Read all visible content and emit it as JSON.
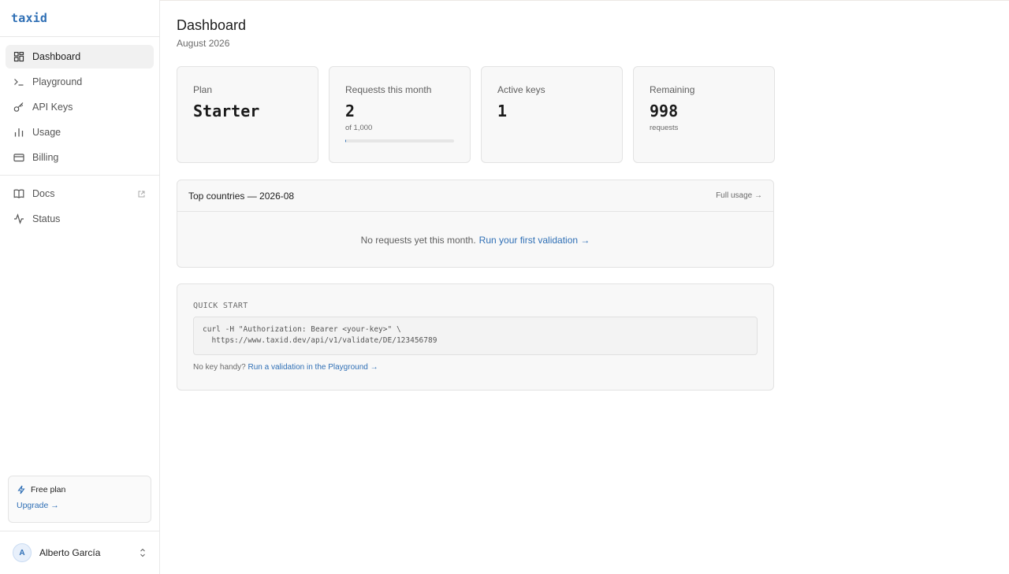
{
  "app": {
    "logo": "taxid"
  },
  "sidebar": {
    "items": [
      {
        "label": "Dashboard",
        "icon": "dashboard-icon",
        "active": true
      },
      {
        "label": "Playground",
        "icon": "terminal-icon"
      },
      {
        "label": "API Keys",
        "icon": "key-icon"
      },
      {
        "label": "Usage",
        "icon": "bar-chart-icon"
      },
      {
        "label": "Billing",
        "icon": "credit-card-icon"
      }
    ],
    "secondary": [
      {
        "label": "Docs",
        "icon": "book-icon",
        "external": true
      },
      {
        "label": "Status",
        "icon": "activity-icon"
      }
    ],
    "plan": {
      "label": "Free plan",
      "upgrade": "Upgrade →"
    },
    "user": {
      "initial": "A",
      "name": "Alberto García"
    }
  },
  "header": {
    "title": "Dashboard",
    "subtitle": "August 2026"
  },
  "cards": [
    {
      "label": "Plan",
      "value": "Starter"
    },
    {
      "label": "Requests this month",
      "value": "2",
      "sub": "of 1,000",
      "progress": 0.002
    },
    {
      "label": "Active keys",
      "value": "1"
    },
    {
      "label": "Remaining",
      "value": "998",
      "sub": "requests"
    }
  ],
  "countries": {
    "title": "Top countries — 2026-08",
    "link": "Full usage →",
    "empty_text": "No requests yet this month.",
    "empty_link": "Run your first validation →"
  },
  "quick_start": {
    "title": "QUICK START",
    "code": "curl -H \"Authorization: Bearer <your-key>\" \\\n  https://www.taxid.dev/api/v1/validate/DE/123456789",
    "foot_text": "No key handy?",
    "foot_link": "Run a validation in the Playground →"
  },
  "colors": {
    "accent": "#2f6fb5",
    "card_bg": "#f8f8f8",
    "border": "#e3e3e3"
  }
}
